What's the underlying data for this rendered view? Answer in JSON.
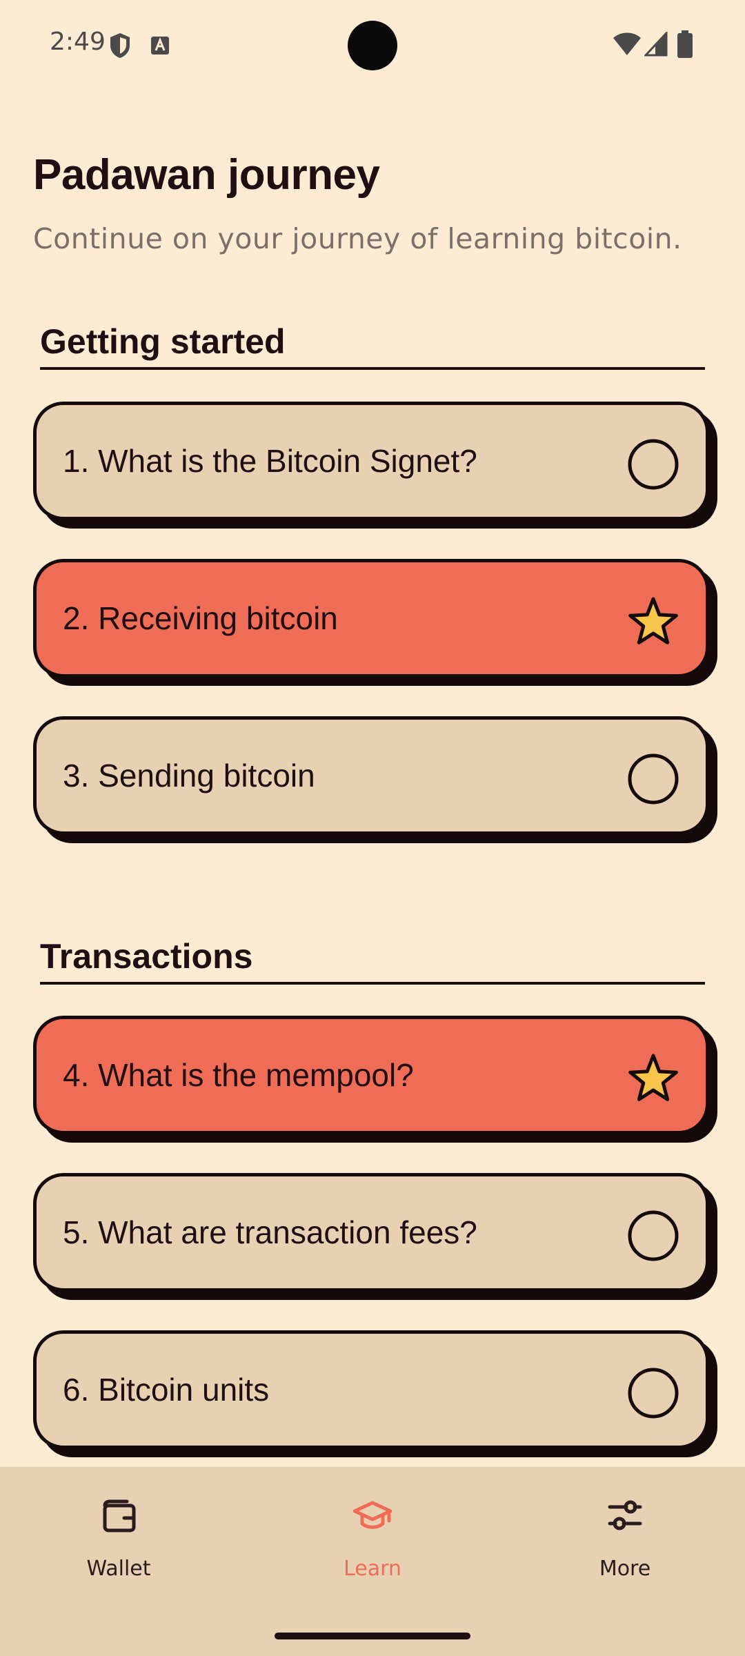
{
  "status_bar": {
    "time": "2:49"
  },
  "header": {
    "title": "Padawan journey",
    "subtitle": "Continue on your journey of learning bitcoin."
  },
  "sections": [
    {
      "title": "Getting started",
      "lessons": [
        {
          "label": "1. What is the Bitcoin Signet?",
          "completed": false
        },
        {
          "label": "2. Receiving bitcoin",
          "completed": true
        },
        {
          "label": "3. Sending bitcoin",
          "completed": false
        }
      ]
    },
    {
      "title": "Transactions",
      "lessons": [
        {
          "label": "4. What is the mempool?",
          "completed": true
        },
        {
          "label": "5. What are transaction fees?",
          "completed": false
        },
        {
          "label": "6. Bitcoin units",
          "completed": false
        }
      ]
    }
  ],
  "bottom_nav": {
    "items": [
      {
        "label": "Wallet",
        "icon": "wallet-icon",
        "active": false
      },
      {
        "label": "Learn",
        "icon": "graduation-cap-icon",
        "active": true
      },
      {
        "label": "More",
        "icon": "sliders-icon",
        "active": false
      }
    ]
  },
  "colors": {
    "background": "#fdebd4",
    "card_pending": "#e8d0b3",
    "card_done": "#ef6c57",
    "star": "#f6c54a",
    "accent": "#ef6c57"
  }
}
